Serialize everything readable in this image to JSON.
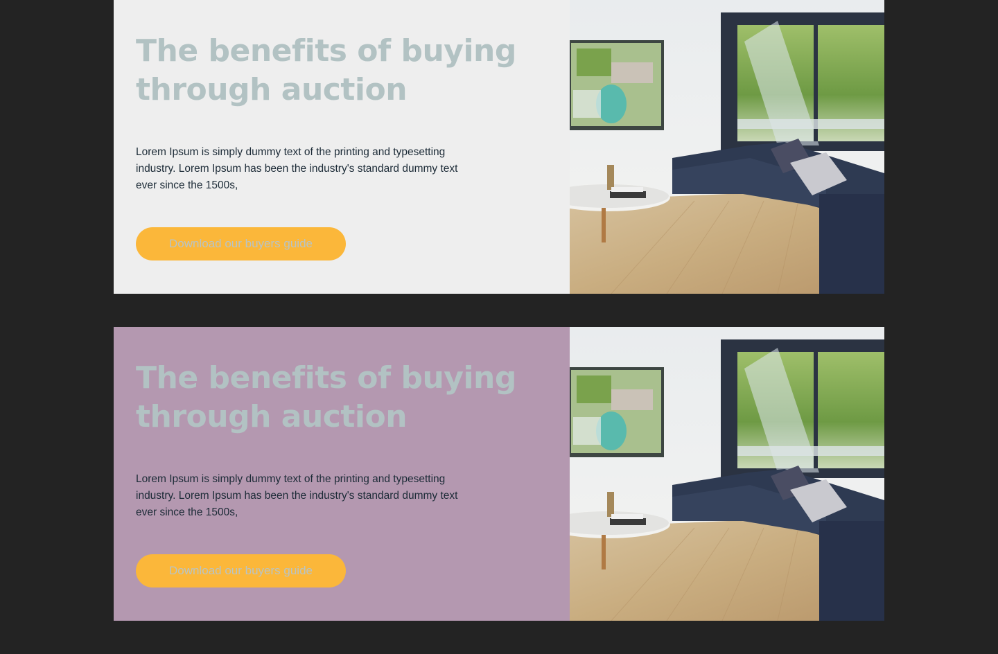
{
  "promos": [
    {
      "title": "The benefits of buying through auction",
      "body": "Lorem Ipsum is simply dummy text of the printing and typesetting industry. Lorem Ipsum has been the industry's standard dummy text ever since the 1500s,",
      "cta_label": "Download our buyers guide",
      "background": "#eeeeee"
    },
    {
      "title": "The benefits of buying through auction",
      "body": "Lorem Ipsum is simply dummy text of the printing and typesetting industry. Lorem Ipsum has been the industry's standard dummy text ever since the 1500s,",
      "cta_label": "Download our buyers guide",
      "background": "#b498b0"
    }
  ],
  "colors": {
    "page_background": "#232323",
    "heading": "#b2c2c3",
    "body_text": "#1b2a36",
    "cta_background": "#fbb73a",
    "cta_text": "#b8c4c6"
  }
}
